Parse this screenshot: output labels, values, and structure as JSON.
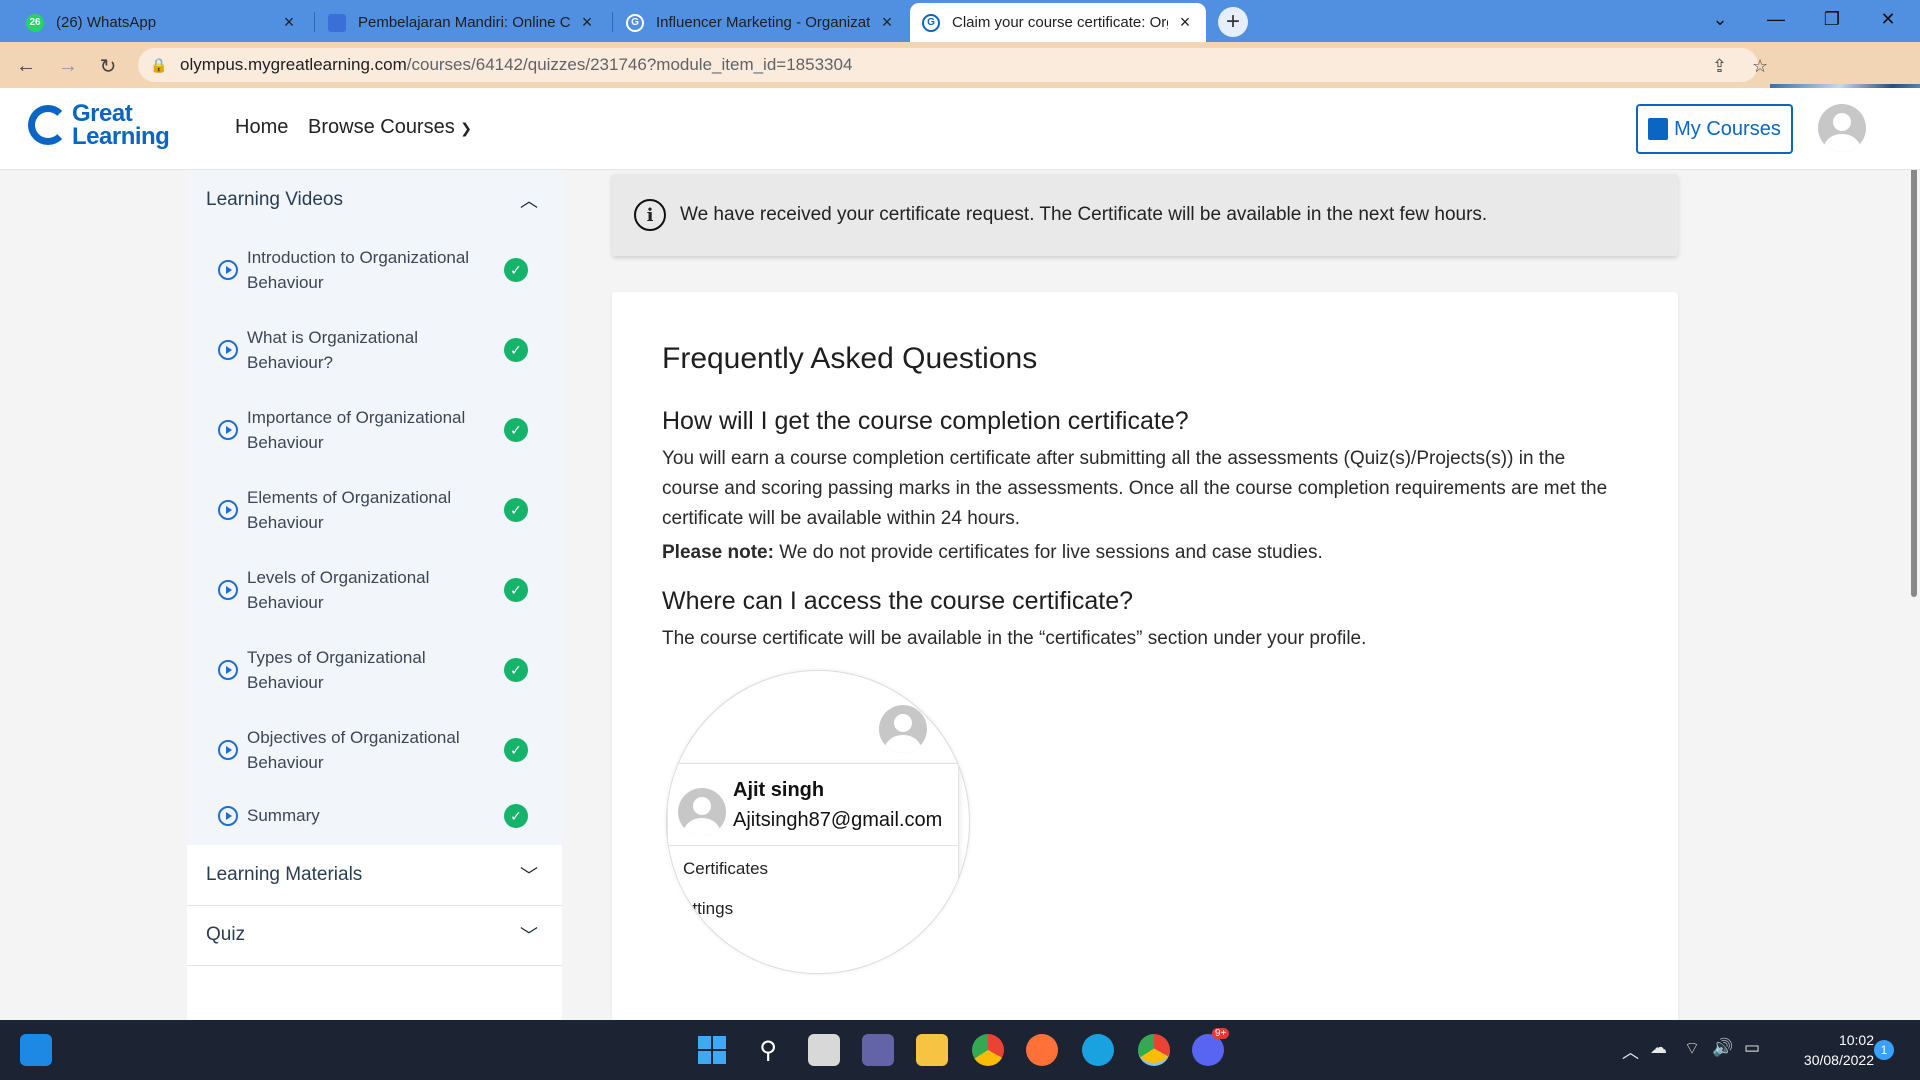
{
  "browser": {
    "tabs": [
      {
        "title": "(26) WhatsApp",
        "badge": "26"
      },
      {
        "title": "Pembelajaran Mandiri: Online Co"
      },
      {
        "title": "Influencer Marketing - Organizat"
      },
      {
        "title": "Claim your course certificate: Org"
      }
    ],
    "address": {
      "host": "olympus.mygreatlearning.com",
      "path": "/courses/64142/quizzes/231746?module_item_id=1853304"
    }
  },
  "header": {
    "logo_line1": "Great",
    "logo_line2": "Learning",
    "nav": {
      "home": "Home",
      "browse": "Browse Courses"
    },
    "my_courses": "My Courses"
  },
  "sidebar": {
    "learning_videos": "Learning Videos",
    "items": [
      {
        "label": "Introduction to Organizational Behaviour"
      },
      {
        "label": "What is Organizational Behaviour?"
      },
      {
        "label": "Importance of Organizational Behaviour"
      },
      {
        "label": "Elements of Organizational Behaviour"
      },
      {
        "label": "Levels of Organizational Behaviour"
      },
      {
        "label": "Types of Organizational Behaviour"
      },
      {
        "label": "Objectives of Organizational Behaviour"
      },
      {
        "label": "Summary"
      }
    ],
    "learning_materials": "Learning Materials",
    "quiz": "Quiz"
  },
  "notice": {
    "text": "We have received your certificate request. The Certificate will be available in the next few hours."
  },
  "faq": {
    "title": "Frequently Asked Questions",
    "q1": "How will I get the course completion certificate?",
    "a1": "You will earn a course completion certificate after submitting all the assessments (Quiz(s)/Projects(s)) in the course and scoring passing marks in the assessments. Once all the course completion requirements are met the certificate will be available within 24 hours.",
    "note_label": "Please note:",
    "note_text": "We do not provide certificates for live sessions and case studies.",
    "q2": "Where can I access the course certificate?",
    "a2": "The course certificate will be available in the “certificates” section under your profile."
  },
  "magnifier": {
    "name": "Ajit singh",
    "email": "Ajitsingh87@gmail.com",
    "link1": "Certificates",
    "link2": "ettings"
  },
  "taskbar": {
    "time": "10:02",
    "date": "30/08/2022",
    "notifications": "1",
    "discord_badge": "9+"
  },
  "colors": {
    "brand": "#0a66c2",
    "success": "#16b36b",
    "tab_strip": "#5190e0",
    "address_bar": "#f2d5b5",
    "taskbar": "#1c2333"
  }
}
